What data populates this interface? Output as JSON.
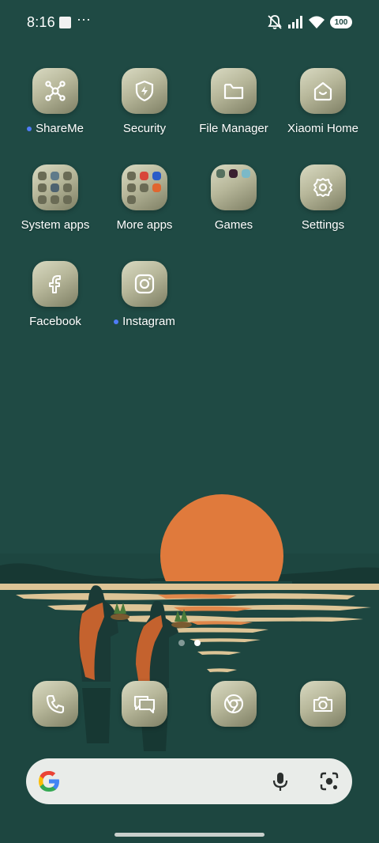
{
  "status_bar": {
    "time": "8:16",
    "more": "···",
    "battery": "100",
    "icons": [
      "notification-square-icon",
      "mute-icon",
      "signal-icon",
      "wifi-icon",
      "battery-icon"
    ]
  },
  "apps": [
    {
      "label": "ShareMe",
      "icon": "share-icon",
      "new_indicator": true
    },
    {
      "label": "Security",
      "icon": "shield-icon",
      "new_indicator": false
    },
    {
      "label": "File Manager",
      "icon": "folder-icon",
      "new_indicator": false
    },
    {
      "label": "Xiaomi Home",
      "icon": "home-icon",
      "new_indicator": false
    },
    {
      "label": "System apps",
      "icon": "folder-grid-icon",
      "new_indicator": false
    },
    {
      "label": "More apps",
      "icon": "folder-grid-icon",
      "new_indicator": false
    },
    {
      "label": "Games",
      "icon": "folder-grid-icon",
      "new_indicator": false
    },
    {
      "label": "Settings",
      "icon": "gear-icon",
      "new_indicator": false
    },
    {
      "label": "Facebook",
      "icon": "facebook-icon",
      "new_indicator": false
    },
    {
      "label": "Instagram",
      "icon": "instagram-icon",
      "new_indicator": true
    }
  ],
  "page_indicator": {
    "pages": 2,
    "current": 2
  },
  "dock": [
    "phone-icon",
    "messages-icon",
    "chrome-icon",
    "camera-icon"
  ],
  "search": {
    "icons": [
      "google-g-icon",
      "microphone-icon",
      "google-lens-icon"
    ]
  },
  "colors": {
    "background": "#1f4a44",
    "sun": "#e07a3c",
    "new_dot": "#4f7cf7"
  }
}
